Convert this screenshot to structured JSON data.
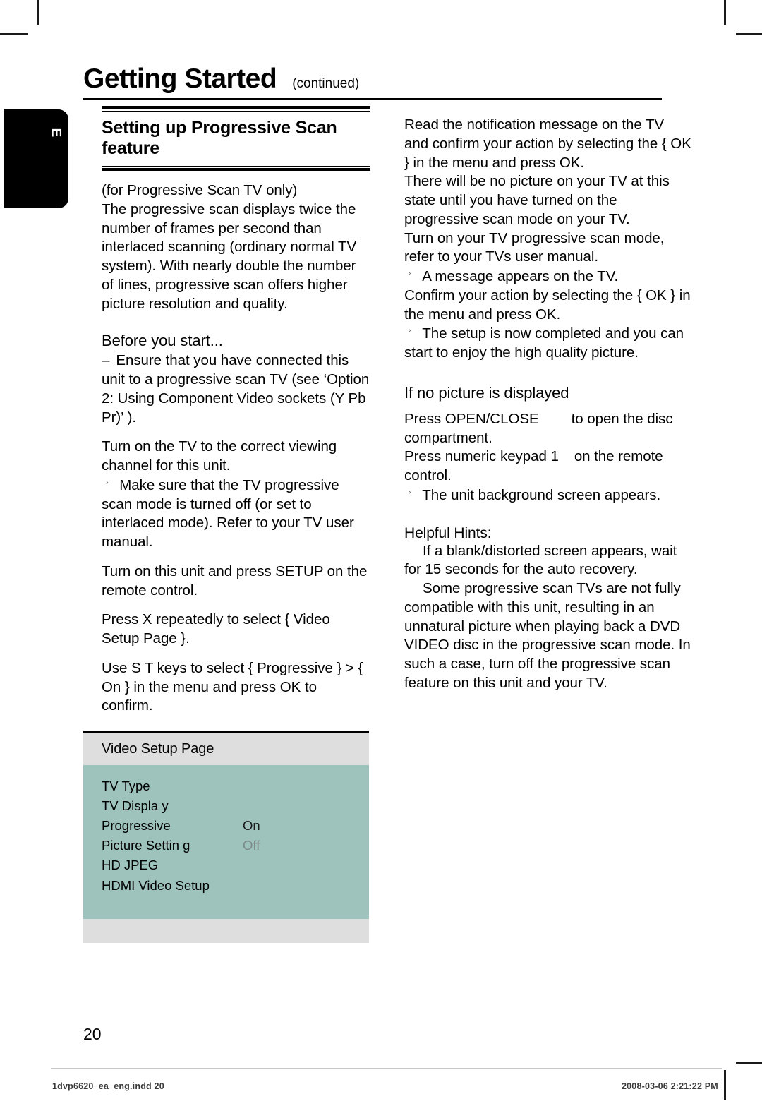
{
  "crop_marks": {
    "present": true
  },
  "language_tab": {
    "letter": "E"
  },
  "header": {
    "title": "Getting Started",
    "continued": "(continued)"
  },
  "left_column": {
    "section_title": "Setting up Progressive Scan feature",
    "intro_note": "(for Progressive Scan TV only)",
    "intro_body": "The progressive scan displays twice the number of frames per second than interlaced scanning (ordinary normal TV system). With nearly double the number of lines, progressive scan offers higher picture resolution and quality.",
    "before_you_start_head": "Before you start...",
    "dash": "–",
    "before_you_start_body": "Ensure that you have connected this unit to a progressive scan TV (see ‘Option 2: Using Component Video sockets (Y Pb Pr)’ ).",
    "step_1": "Turn on the TV to the correct viewing channel for this unit.",
    "step_1_note": "Make sure that the TV progressive scan mode is turned off (or set to interlaced mode). Refer to your TV user manual.",
    "step_2": "Turn on this unit and press SETUP on the remote control.",
    "step_3": "Press  X repeatedly to select { Video Setup Page }.",
    "step_4": "Use  S T  keys to select { Progressive } > { On } in the menu and press OK to confirm.",
    "osd": {
      "title": "Video Setup Page",
      "rows": [
        {
          "label": "TV Type",
          "value": "",
          "value_state": "none"
        },
        {
          "label": "TV Displa y",
          "value": "",
          "value_state": "none"
        },
        {
          "label": "Progressive",
          "value": "On",
          "value_state": "on"
        },
        {
          "label": "Picture Settin  g",
          "value": "Off",
          "value_state": "off"
        },
        {
          "label": "HD JPEG",
          "value": "",
          "value_state": "none"
        },
        {
          "label": "HDMI Video Setup",
          "value": "",
          "value_state": "none"
        }
      ]
    }
  },
  "right_column": {
    "step_5": "Read the notification message on the TV and confirm your action by selecting the { OK } in the menu and press OK.",
    "warning": "There will be no picture on your TV at this state until you have turned on the progressive scan mode on your TV.",
    "step_6": "Turn on your TV progressive scan mode, refer to your TVs user manual.",
    "step_6_note": "A message appears on the TV.",
    "step_7": "Confirm your action by selecting the { OK } in the menu and press OK.",
    "step_7_note": "The setup is now completed and you can start to enjoy the high quality picture.",
    "no_picture_head": "If no picture is displayed",
    "np_step_1a": "Press OPEN/CLOSE",
    "np_step_1b": "to open the disc compartment.",
    "np_step_2a": "Press numeric keypad  1",
    "np_step_2b": "on the remote control.",
    "np_step_2_note": "The unit background screen appears.",
    "hints_head": "Helpful Hints:",
    "hint_1": "If a blank/distorted screen appears, wait for 15 seconds for the auto recovery.",
    "hint_2": "Some progressive scan TVs are not fully compatible with this unit, resulting in an unnatural picture when playing back a DVD VIDEO disc in the progressive scan mode. In such a case, turn off the progressive scan feature on this unit and your TV."
  },
  "page_number": "20",
  "print_footer": {
    "file": "1dvp6620_ea_eng.indd   20",
    "date": "2008-03-06   2:21:22 PM"
  },
  "colors": {
    "osd_body": "#9ec3bd",
    "osd_bar": "#dedede",
    "value_off": "#7d8a88",
    "tab": "#000000"
  }
}
